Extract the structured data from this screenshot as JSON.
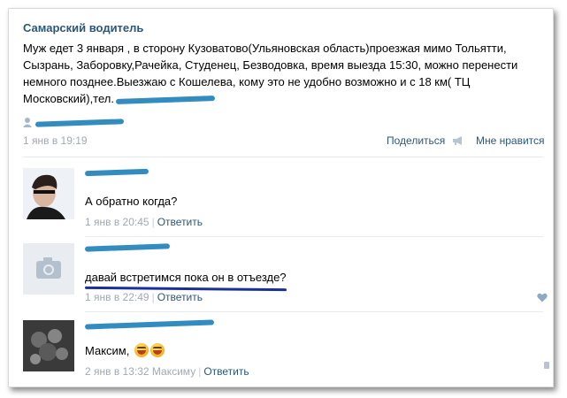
{
  "post": {
    "author": "Самарский водитель",
    "text": "Муж едет 3 января , в сторону Кузоватово(Ульяновская область)проезжая мимо Тольятти, Сызрань, Заборовку,Рачейка, Студенец, Безводовка, время выезда 15:30, можно перенести немного позднее.Выезжаю с Кошелева, кому это не удобно возможно и с 18 км( ТЦ Московский),тел.",
    "date": "1 янв в 19:19",
    "share_label": "Поделиться",
    "like_label": "Мне нравится"
  },
  "comments": [
    {
      "text": "А обратно когда?",
      "date": "1 янв в 20:45",
      "reply_label": "Ответить"
    },
    {
      "text": "давай встретимся пока он в отъезде?",
      "date": "1 янв в 22:49",
      "reply_label": "Ответить"
    },
    {
      "text": "Максим,",
      "date": "2 янв в 13:32 Максиму",
      "reply_label": "Ответить"
    }
  ],
  "colors": {
    "link": "#2b587a",
    "meta": "#a0a9b4",
    "scribble": "#1d7fb8",
    "underline": "#1b2f9a"
  }
}
